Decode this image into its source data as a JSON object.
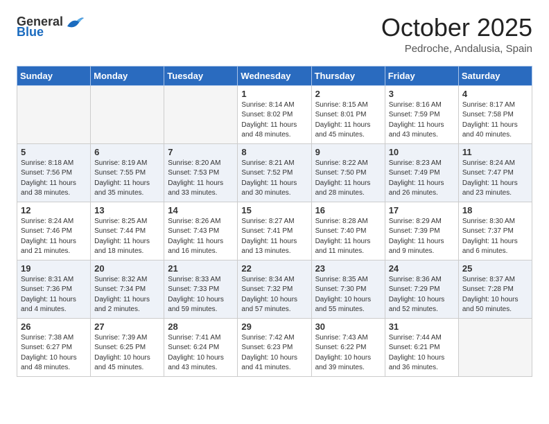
{
  "header": {
    "logo_general": "General",
    "logo_blue": "Blue",
    "month_title": "October 2025",
    "location": "Pedroche, Andalusia, Spain"
  },
  "days_of_week": [
    "Sunday",
    "Monday",
    "Tuesday",
    "Wednesday",
    "Thursday",
    "Friday",
    "Saturday"
  ],
  "weeks": [
    [
      {
        "day": "",
        "empty": true
      },
      {
        "day": "",
        "empty": true
      },
      {
        "day": "",
        "empty": true
      },
      {
        "day": "1",
        "sunrise": "8:14 AM",
        "sunset": "8:02 PM",
        "daylight": "11 hours and 48 minutes."
      },
      {
        "day": "2",
        "sunrise": "8:15 AM",
        "sunset": "8:01 PM",
        "daylight": "11 hours and 45 minutes."
      },
      {
        "day": "3",
        "sunrise": "8:16 AM",
        "sunset": "7:59 PM",
        "daylight": "11 hours and 43 minutes."
      },
      {
        "day": "4",
        "sunrise": "8:17 AM",
        "sunset": "7:58 PM",
        "daylight": "11 hours and 40 minutes."
      }
    ],
    [
      {
        "day": "5",
        "sunrise": "8:18 AM",
        "sunset": "7:56 PM",
        "daylight": "11 hours and 38 minutes."
      },
      {
        "day": "6",
        "sunrise": "8:19 AM",
        "sunset": "7:55 PM",
        "daylight": "11 hours and 35 minutes."
      },
      {
        "day": "7",
        "sunrise": "8:20 AM",
        "sunset": "7:53 PM",
        "daylight": "11 hours and 33 minutes."
      },
      {
        "day": "8",
        "sunrise": "8:21 AM",
        "sunset": "7:52 PM",
        "daylight": "11 hours and 30 minutes."
      },
      {
        "day": "9",
        "sunrise": "8:22 AM",
        "sunset": "7:50 PM",
        "daylight": "11 hours and 28 minutes."
      },
      {
        "day": "10",
        "sunrise": "8:23 AM",
        "sunset": "7:49 PM",
        "daylight": "11 hours and 26 minutes."
      },
      {
        "day": "11",
        "sunrise": "8:24 AM",
        "sunset": "7:47 PM",
        "daylight": "11 hours and 23 minutes."
      }
    ],
    [
      {
        "day": "12",
        "sunrise": "8:24 AM",
        "sunset": "7:46 PM",
        "daylight": "11 hours and 21 minutes."
      },
      {
        "day": "13",
        "sunrise": "8:25 AM",
        "sunset": "7:44 PM",
        "daylight": "11 hours and 18 minutes."
      },
      {
        "day": "14",
        "sunrise": "8:26 AM",
        "sunset": "7:43 PM",
        "daylight": "11 hours and 16 minutes."
      },
      {
        "day": "15",
        "sunrise": "8:27 AM",
        "sunset": "7:41 PM",
        "daylight": "11 hours and 13 minutes."
      },
      {
        "day": "16",
        "sunrise": "8:28 AM",
        "sunset": "7:40 PM",
        "daylight": "11 hours and 11 minutes."
      },
      {
        "day": "17",
        "sunrise": "8:29 AM",
        "sunset": "7:39 PM",
        "daylight": "11 hours and 9 minutes."
      },
      {
        "day": "18",
        "sunrise": "8:30 AM",
        "sunset": "7:37 PM",
        "daylight": "11 hours and 6 minutes."
      }
    ],
    [
      {
        "day": "19",
        "sunrise": "8:31 AM",
        "sunset": "7:36 PM",
        "daylight": "11 hours and 4 minutes."
      },
      {
        "day": "20",
        "sunrise": "8:32 AM",
        "sunset": "7:34 PM",
        "daylight": "11 hours and 2 minutes."
      },
      {
        "day": "21",
        "sunrise": "8:33 AM",
        "sunset": "7:33 PM",
        "daylight": "10 hours and 59 minutes."
      },
      {
        "day": "22",
        "sunrise": "8:34 AM",
        "sunset": "7:32 PM",
        "daylight": "10 hours and 57 minutes."
      },
      {
        "day": "23",
        "sunrise": "8:35 AM",
        "sunset": "7:30 PM",
        "daylight": "10 hours and 55 minutes."
      },
      {
        "day": "24",
        "sunrise": "8:36 AM",
        "sunset": "7:29 PM",
        "daylight": "10 hours and 52 minutes."
      },
      {
        "day": "25",
        "sunrise": "8:37 AM",
        "sunset": "7:28 PM",
        "daylight": "10 hours and 50 minutes."
      }
    ],
    [
      {
        "day": "26",
        "sunrise": "7:38 AM",
        "sunset": "6:27 PM",
        "daylight": "10 hours and 48 minutes."
      },
      {
        "day": "27",
        "sunrise": "7:39 AM",
        "sunset": "6:25 PM",
        "daylight": "10 hours and 45 minutes."
      },
      {
        "day": "28",
        "sunrise": "7:41 AM",
        "sunset": "6:24 PM",
        "daylight": "10 hours and 43 minutes."
      },
      {
        "day": "29",
        "sunrise": "7:42 AM",
        "sunset": "6:23 PM",
        "daylight": "10 hours and 41 minutes."
      },
      {
        "day": "30",
        "sunrise": "7:43 AM",
        "sunset": "6:22 PM",
        "daylight": "10 hours and 39 minutes."
      },
      {
        "day": "31",
        "sunrise": "7:44 AM",
        "sunset": "6:21 PM",
        "daylight": "10 hours and 36 minutes."
      },
      {
        "day": "",
        "empty": true
      }
    ]
  ]
}
